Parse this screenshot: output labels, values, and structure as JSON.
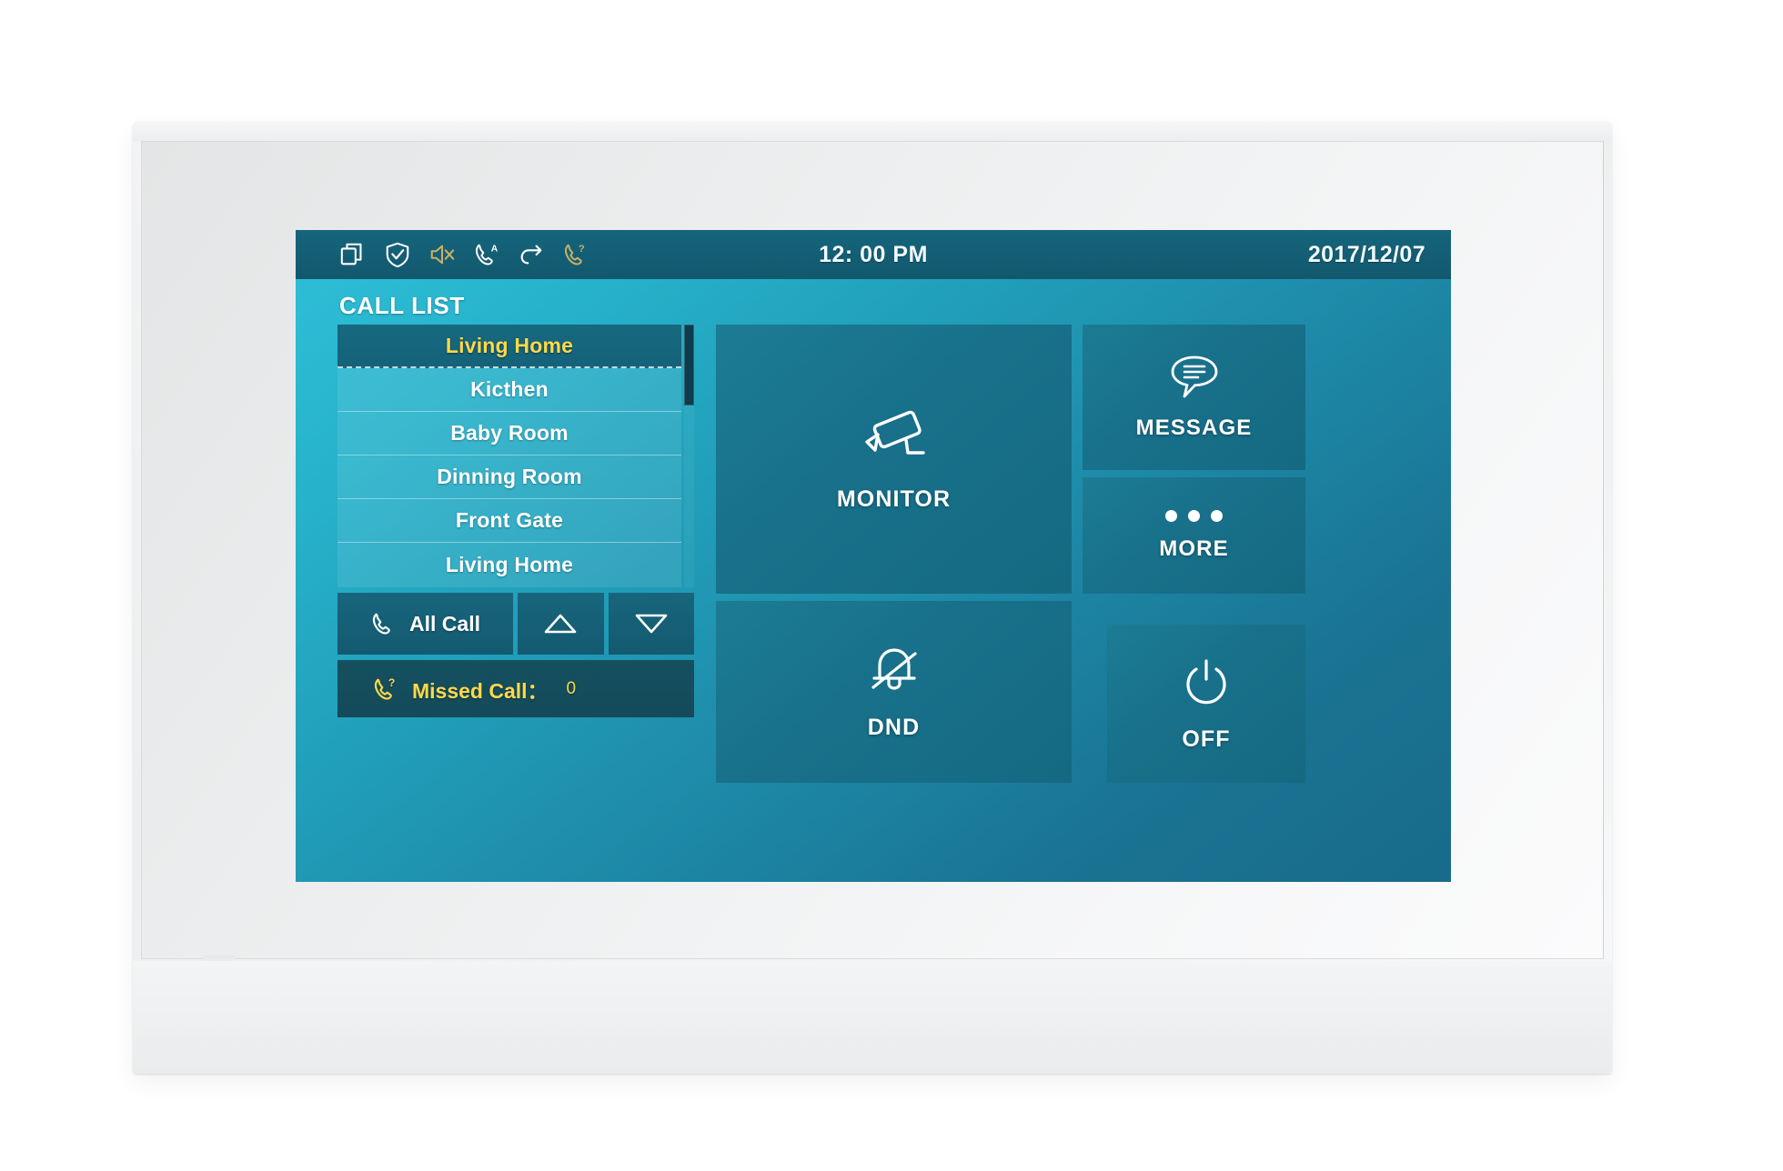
{
  "device": {
    "type": "indoor-video-intercom-monitor"
  },
  "statusbar": {
    "time": "12: 00  PM",
    "date": "2017/12/07",
    "icons": [
      {
        "name": "multi-window-icon",
        "title": "Multi Window",
        "color": "#ffffff"
      },
      {
        "name": "shield-check-icon",
        "title": "Security Armed",
        "color": "#ffffff"
      },
      {
        "name": "speaker-mute-icon",
        "title": "Sound Muted",
        "color": "#c9b068"
      },
      {
        "name": "phone-auto-answer-icon",
        "title": "Auto Answer",
        "color": "#ffffff"
      },
      {
        "name": "call-forward-icon",
        "title": "Call Forward",
        "color": "#ffffff"
      },
      {
        "name": "phone-missed-icon",
        "title": "Missed Call",
        "color": "#c9b068"
      }
    ]
  },
  "main": {
    "call_list_title": "CALL LIST",
    "call_list": [
      {
        "label": "Living Home",
        "selected": true
      },
      {
        "label": "Kicthen",
        "selected": false
      },
      {
        "label": "Baby Room",
        "selected": false
      },
      {
        "label": "Dinning Room",
        "selected": false
      },
      {
        "label": "Front Gate",
        "selected": false
      },
      {
        "label": "Living Home",
        "selected": false
      }
    ],
    "controls": {
      "all_call_label": "All Call",
      "scroll_up_label": "Scroll Up",
      "scroll_down_label": "Scroll Down"
    },
    "missed_call": {
      "label": "Missed Call：",
      "count": "0"
    },
    "tiles": [
      {
        "id": "monitor",
        "label": "MONITOR",
        "icon": "cctv-camera-icon"
      },
      {
        "id": "message",
        "label": "MESSAGE",
        "icon": "speech-bubble-icon"
      },
      {
        "id": "more",
        "label": "MORE",
        "icon": "ellipsis-icon"
      },
      {
        "id": "dnd",
        "label": "DND",
        "icon": "bell-muted-icon"
      },
      {
        "id": "off",
        "label": "OFF",
        "icon": "power-icon"
      }
    ]
  },
  "colors": {
    "accent_yellow": "#ffd94a",
    "screen_top": "#2ec0d8",
    "screen_bottom": "#186b8a",
    "statusbar": "#15657c",
    "tile": "#18708a",
    "selected_row": "#16697f"
  }
}
